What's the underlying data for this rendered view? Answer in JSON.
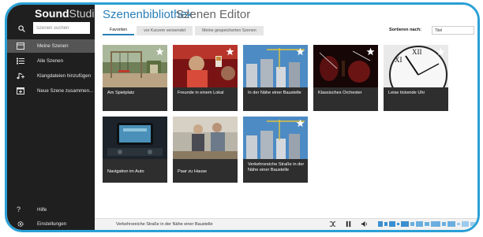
{
  "app": {
    "brand_bold": "Sound",
    "brand_light": "Studio"
  },
  "search": {
    "placeholder": "Szenen suchen"
  },
  "sidebar": {
    "items": [
      {
        "label": "Meine Szenen",
        "icon": "scenes-icon"
      },
      {
        "label": "Alle Szenen",
        "icon": "list-icon"
      },
      {
        "label": "Klangdateien hinzufügen",
        "icon": "music-note-icon"
      },
      {
        "label": "Neue Szene zusammen...",
        "icon": "new-scene-icon"
      }
    ],
    "bottom": [
      {
        "label": "Hilfe",
        "icon": "help-icon"
      },
      {
        "label": "Einstellungen",
        "icon": "settings-icon"
      }
    ]
  },
  "header": {
    "library_title": "Szenenbibliothek",
    "editor_title": "Szenen Editor"
  },
  "tabs": [
    "Favoriten",
    "vor Kurzem verwendet",
    "Meine gespeicherten Szenen"
  ],
  "sort": {
    "label": "Sortieren nach:",
    "value": "Titel"
  },
  "cards": [
    {
      "caption": "Am Spielplatz"
    },
    {
      "caption": "Freunde in einem Lokal"
    },
    {
      "caption": "In der Nähe einer Baustelle"
    },
    {
      "caption": "Klassisches Orchester"
    },
    {
      "caption": "Leise tickende Uhr"
    },
    {
      "caption": "Navigation im Auto"
    },
    {
      "caption": "Paar zu Hause"
    },
    {
      "caption": "Verkehrsreiche Straße in der Nähe einer Baustelle"
    }
  ],
  "player": {
    "now_playing": "Verkehrsreiche Straße in der Nähe einer Baustelle"
  },
  "colors": {
    "accent": "#2a7fb8",
    "frame": "#2aa0d6",
    "sidebar": "#1f1f1f",
    "sidebar_active": "#555555",
    "card": "#2e2e2e"
  }
}
